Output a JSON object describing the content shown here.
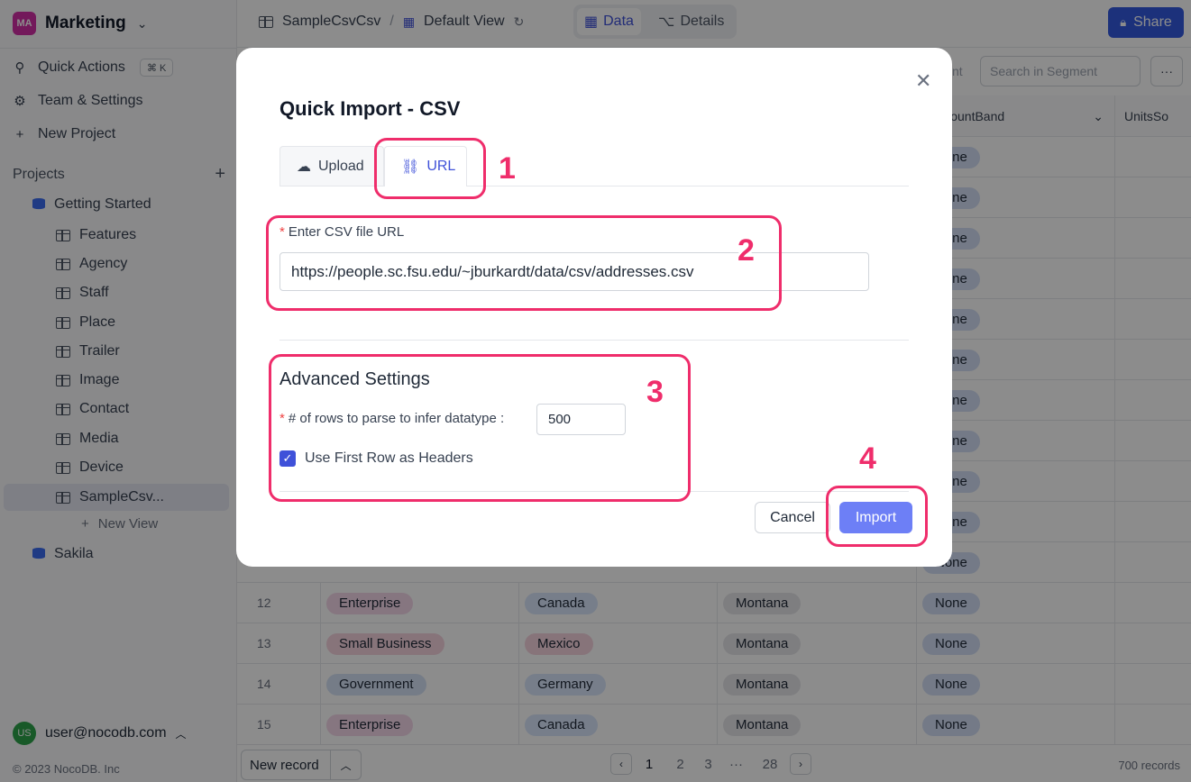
{
  "workspace": {
    "badge": "MA",
    "name": "Marketing"
  },
  "sidebar": {
    "actions": [
      {
        "label": "Quick Actions",
        "shortcut": "⌘ K",
        "icon": "search-icon"
      },
      {
        "label": "Team & Settings",
        "icon": "gear-icon"
      },
      {
        "label": "New Project",
        "icon": "plus-icon"
      }
    ],
    "projects_label": "Projects",
    "project1": "Getting Started",
    "tables": [
      "Features",
      "Agency",
      "Staff",
      "Place",
      "Trailer",
      "Image",
      "Contact",
      "Media",
      "Device",
      "SampleCsv..."
    ],
    "new_view": "New View",
    "project2": "Sakila",
    "user": {
      "initials": "US",
      "email": "user@nocodb.com"
    },
    "copyright": "© 2023 NocoDB. Inc"
  },
  "topbar": {
    "table": "SampleCsvCsv",
    "view": "Default View",
    "tabs": [
      "Data",
      "Details"
    ],
    "share": "Share"
  },
  "toolbar": {
    "search_placeholder": "Search in Segment",
    "partial": "nt"
  },
  "grid": {
    "headers": {
      "discount": "DiscountBand",
      "units": "UnitsSo"
    },
    "partial_rows": [
      {
        "discount": "None"
      },
      {
        "discount": "None"
      },
      {
        "discount": "None"
      },
      {
        "discount": "None"
      },
      {
        "discount": "None"
      },
      {
        "discount": "None"
      },
      {
        "discount": "None"
      },
      {
        "discount": "None"
      },
      {
        "discount": "None"
      },
      {
        "discount": "None"
      },
      {
        "discount": "None"
      }
    ],
    "rows": [
      {
        "n": "12",
        "segment": "Enterprise",
        "country": "Canada",
        "product": "Montana",
        "discount": "None"
      },
      {
        "n": "13",
        "segment": "Small Business",
        "country": "Mexico",
        "product": "Montana",
        "discount": "None"
      },
      {
        "n": "14",
        "segment": "Government",
        "country": "Germany",
        "product": "Montana",
        "discount": "None"
      },
      {
        "n": "15",
        "segment": "Enterprise",
        "country": "Canada",
        "product": "Montana",
        "discount": "None"
      }
    ]
  },
  "footer": {
    "new_record": "New record",
    "pages": [
      "1",
      "2",
      "3",
      "···",
      "28"
    ],
    "records": "700 records"
  },
  "modal": {
    "title": "Quick Import - CSV",
    "tabs": {
      "upload": "Upload",
      "url": "URL"
    },
    "url_label": "Enter CSV file URL",
    "url_value": "https://people.sc.fsu.edu/~jburkardt/data/csv/addresses.csv",
    "advanced_title": "Advanced Settings",
    "rows_label": "# of rows to parse to infer datatype",
    "rows_value": "500",
    "checkbox_label": "Use First Row as Headers",
    "cancel": "Cancel",
    "import": "Import"
  },
  "annotations": [
    "1",
    "2",
    "3",
    "4"
  ],
  "colors": {
    "accent": "#3f51d9",
    "annotation": "#ef2d6b",
    "share": "#3359e0",
    "import": "#6d7ff6"
  }
}
